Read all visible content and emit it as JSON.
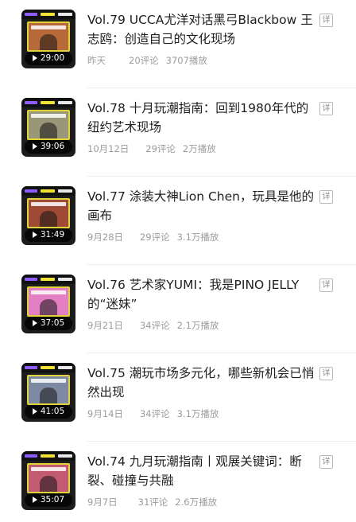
{
  "episodes": [
    {
      "duration": "29:00",
      "title": "Vol.79 UCCA尤洋对话黑弓Blackbow 王志鸥：创造自己的文化现场",
      "date": "昨天",
      "comments": "20评论",
      "plays": "3707播放",
      "detail_label": "详",
      "screen_color": "#b8693a"
    },
    {
      "duration": "39:06",
      "title": "Vol.78 十月玩潮指南：回到1980年代的纽约艺术现场",
      "date": "10月12日",
      "comments": "29评论",
      "plays": "2万播放",
      "detail_label": "详",
      "screen_color": "#9a9678"
    },
    {
      "duration": "31:49",
      "title": "Vol.77 涂装大神Lion Chen，玩具是他的画布",
      "date": "9月28日",
      "comments": "29评论",
      "plays": "3.1万播放",
      "detail_label": "详",
      "screen_color": "#a04a36"
    },
    {
      "duration": "37:05",
      "title": "Vol.76 艺术家YUMI：我是PINO JELLY的“迷妹”",
      "date": "9月21日",
      "comments": "34评论",
      "plays": "2.1万播放",
      "detail_label": "详",
      "screen_color": "#e57fc4"
    },
    {
      "duration": "41:05",
      "title": "Vol.75 潮玩市场多元化，哪些新机会已悄然出现",
      "date": "9月14日",
      "comments": "34评论",
      "plays": "3.1万播放",
      "detail_label": "详",
      "screen_color": "#7e8aa3"
    },
    {
      "duration": "35:07",
      "title": "Vol.74 九月玩潮指南丨观展关键词：断裂、碰撞与共融",
      "date": "9月7日",
      "comments": "31评论",
      "plays": "2.6万播放",
      "detail_label": "详",
      "screen_color": "#c25a72"
    }
  ]
}
